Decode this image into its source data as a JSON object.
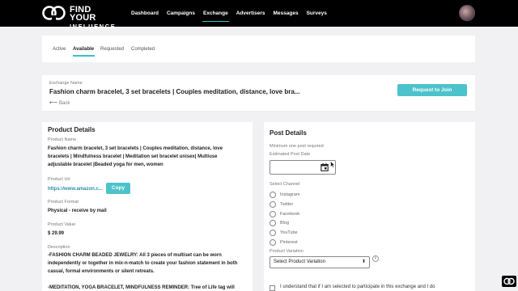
{
  "header": {
    "logo_line1": "FIND YOUR",
    "logo_line2": "INFLUENCE",
    "nav": [
      "Dashboard",
      "Campaigns",
      "Exchange",
      "Advertisers",
      "Messages",
      "Surveys"
    ],
    "active_nav": "Exchange"
  },
  "tabs": [
    "Active",
    "Available",
    "Requested",
    "Completed"
  ],
  "active_tab": "Available",
  "exchange": {
    "label": "Exchange Name",
    "title": "Fashion charm bracelet, 3 set bracelets | Couples meditation, distance, love bra...",
    "back": "Back",
    "join_button": "Request to Join"
  },
  "product": {
    "title": "Product Details",
    "name_label": "Product Name",
    "name_lines": [
      "Fashion charm bracelet, 3 set bracelets | Couples meditation, distance, love",
      "bracelets | Mindfulness bracelet | Meditation set bracelet unisex| Multiuse",
      "adjustable bracelet |Beaded yoga for men, women"
    ],
    "url_label": "Product Url",
    "url": "https://www.amazon.c...",
    "copy_button": "Copy",
    "format_label": "Product Format",
    "format": "Physical - receive by mail",
    "value_label": "Product Value",
    "value": "$ 29.99",
    "desc_label": "Description",
    "desc_lines": [
      "-FASHION CHARM BEADED JEWELRY: All 3 pieces of multiset can be worn",
      "independently or together in mix-n-match to create your fashion statement in both",
      "casual, formal environments or silent retreats.",
      "",
      "-MEDITATION, YOGA BRACELET, MINDFULNESS REMINDER: Tree of Life tag will"
    ]
  },
  "post": {
    "title": "Post Details",
    "min_text": "Minimum one post required",
    "date_label": "Estimated Post Date",
    "channel_label": "Select Channel",
    "channels": [
      "Instagram",
      "Twitter",
      "Facebook",
      "Blog",
      "YouTube",
      "Pinterest"
    ],
    "variation_label": "Product Variation",
    "variation_select": "Select Product Variation",
    "agree_text": "I understand that if I am selected to participate in this exchange and I do"
  },
  "colors": {
    "accent": "#4cc3cb",
    "topbar": "#000000",
    "background": "#f1f1f3"
  }
}
